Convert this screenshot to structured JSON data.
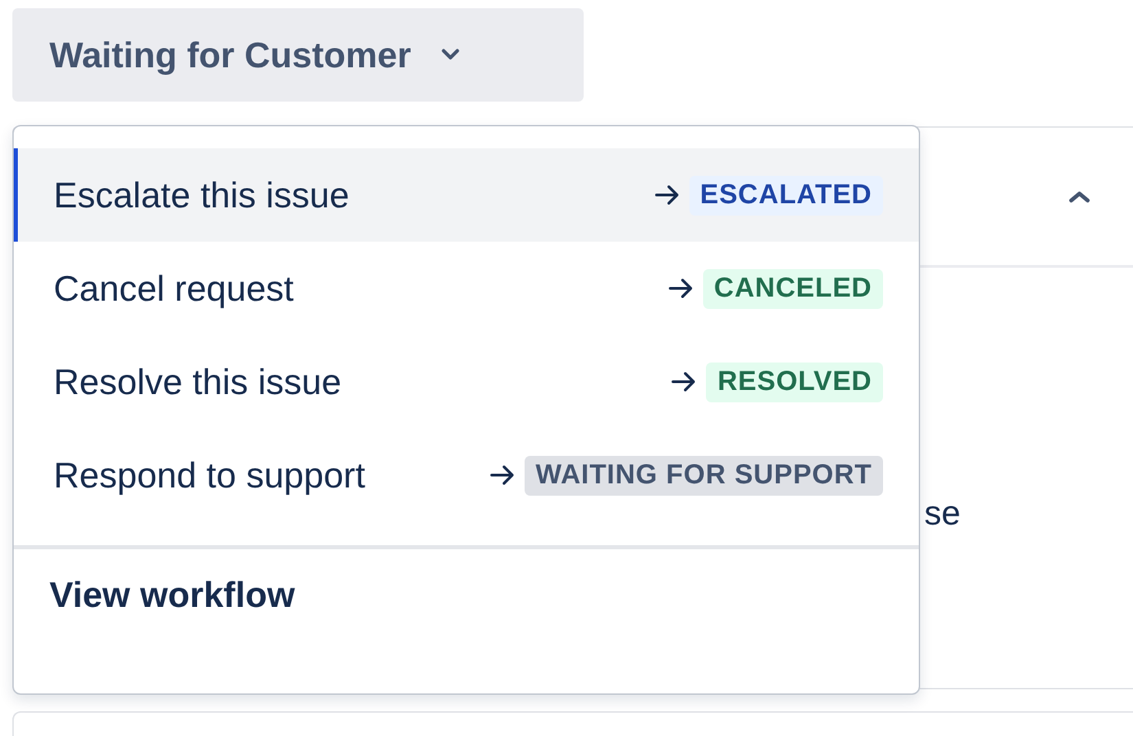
{
  "status_button": {
    "label": "Waiting for Customer"
  },
  "menu": {
    "items": [
      {
        "label": "Escalate this issue",
        "selected": true,
        "target": "ESCALATED",
        "kind": "blue"
      },
      {
        "label": "Cancel request",
        "selected": false,
        "target": "CANCELED",
        "kind": "green"
      },
      {
        "label": "Resolve this issue",
        "selected": false,
        "target": "RESOLVED",
        "kind": "green"
      },
      {
        "label": "Respond to support",
        "selected": false,
        "target": "WAITING FOR SUPPORT",
        "kind": "grey"
      }
    ],
    "footer_link": "View workflow"
  },
  "background_panel": {
    "text": "se"
  }
}
